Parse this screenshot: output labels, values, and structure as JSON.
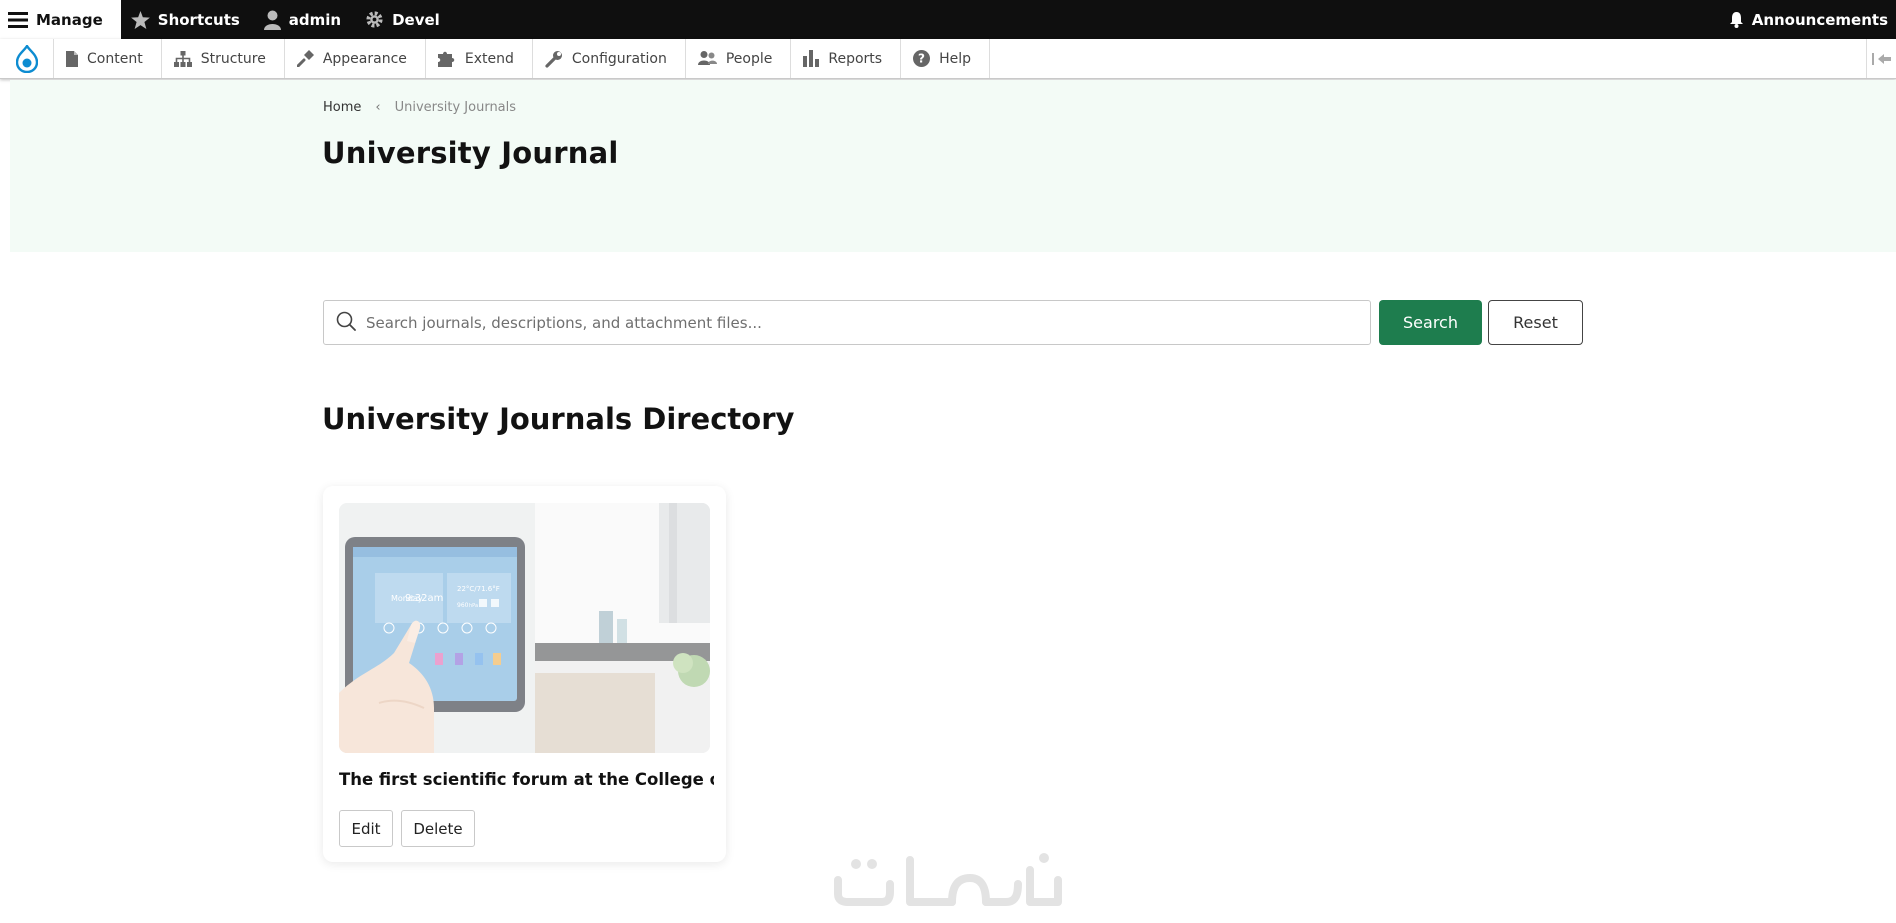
{
  "topbar": {
    "manage": "Manage",
    "shortcuts": "Shortcuts",
    "user": "admin",
    "devel": "Devel",
    "announcements": "Announcements"
  },
  "toolbar": {
    "items": [
      "Content",
      "Structure",
      "Appearance",
      "Extend",
      "Configuration",
      "People",
      "Reports",
      "Help"
    ]
  },
  "breadcrumb": {
    "home": "Home",
    "separator": "‹",
    "current": "University Journals"
  },
  "page": {
    "title": "University Journal"
  },
  "search": {
    "placeholder": "Search journals, descriptions, and attachment files...",
    "value": "",
    "search_label": "Search",
    "reset_label": "Reset"
  },
  "directory": {
    "title": "University Journals Directory",
    "cards": [
      {
        "title": "The first scientific forum at the College of ...",
        "edit_label": "Edit",
        "delete_label": "Delete",
        "image_screen": {
          "day": "Monday",
          "time": "9:32am",
          "temp": "22°C/71.6°F",
          "humidity": "960",
          "humidity_unit": "hPa"
        }
      }
    ]
  },
  "colors": {
    "topbar_bg": "#0f0f0f",
    "hero_bg": "#f3fbf6",
    "primary_button": "#1e7d4e",
    "drupal_blue": "#0d8cd1"
  }
}
